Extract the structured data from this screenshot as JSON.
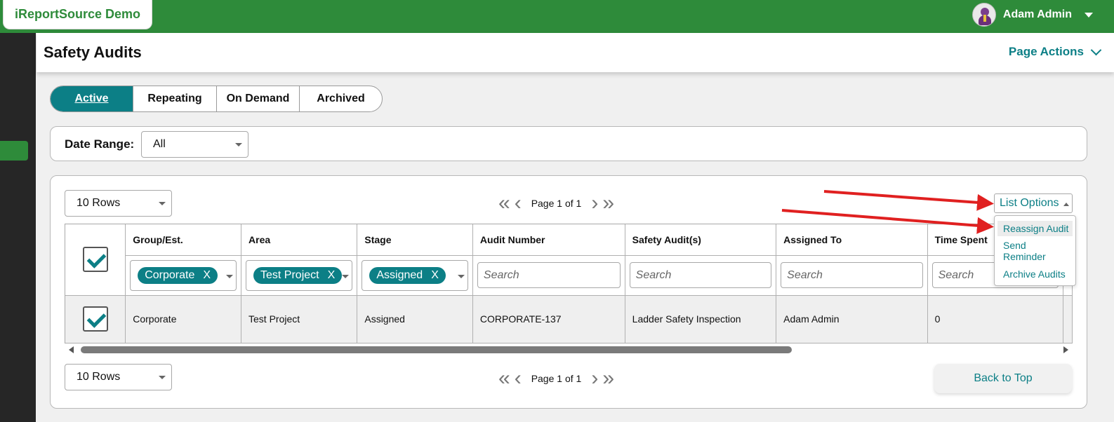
{
  "app": {
    "brand": "iReportSource Demo"
  },
  "user": {
    "name": "Adam Admin"
  },
  "header": {
    "title": "Safety Audits",
    "page_actions": "Page Actions"
  },
  "tabs": [
    {
      "label": "Active",
      "active": true
    },
    {
      "label": "Repeating",
      "active": false
    },
    {
      "label": "On Demand",
      "active": false
    },
    {
      "label": "Archived",
      "active": false
    }
  ],
  "filters": {
    "date_range_label": "Date Range:",
    "date_range_value": "All"
  },
  "pagination": {
    "rows_top": "10 Rows",
    "rows_bottom": "10 Rows",
    "page_text_top": "Page 1 of 1",
    "page_text_bottom": "Page 1 of 1"
  },
  "list_options": {
    "label": "List Options",
    "items": [
      "Reassign Audit",
      "Send\nReminder",
      "Archive Audits"
    ]
  },
  "table": {
    "columns": [
      "Group/Est.",
      "Area",
      "Stage",
      "Audit Number",
      "Safety Audit(s)",
      "Assigned To",
      "Time Spent"
    ],
    "filters": {
      "group_chip": "Corporate",
      "area_chip": "Test Project",
      "stage_chip": "Assigned",
      "chip_remove": "X",
      "search_placeholder": "Search"
    },
    "rows": [
      {
        "group": "Corporate",
        "area": "Test Project",
        "stage": "Assigned",
        "audit_number": "CORPORATE-137",
        "safety_audit": "Ladder Safety Inspection",
        "assigned_to": "Adam Admin",
        "time_spent": "0"
      }
    ]
  },
  "back_to_top": "Back to Top",
  "colors": {
    "brand_green": "#2e8b3a",
    "teal": "#0c7f86",
    "annotation_red": "#e02020",
    "sidebar": "#262626"
  },
  "icons": [
    "avatar-icon",
    "caret-down-icon",
    "chevron-down-icon",
    "first-page-icon",
    "prev-page-icon",
    "next-page-icon",
    "last-page-icon",
    "checkbox-checked-icon",
    "scroll-left-icon",
    "scroll-right-icon"
  ]
}
